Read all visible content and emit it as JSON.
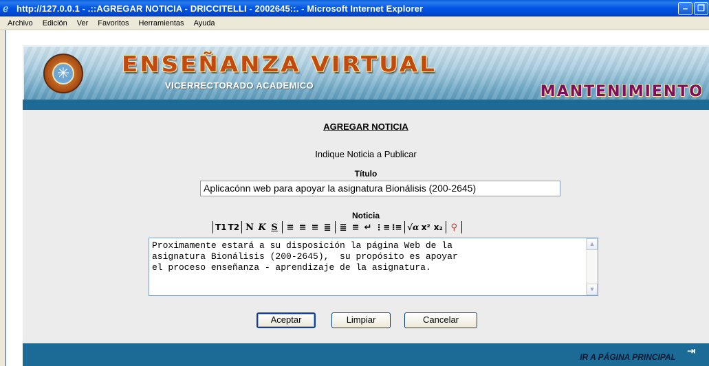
{
  "window": {
    "title": "http://127.0.0.1 - .::AGREGAR NOTICIA - DRICCITELLI - 2002645::. - Microsoft Internet Explorer",
    "minimize": "‒",
    "restore": "❐"
  },
  "menubar": {
    "items": [
      "Archivo",
      "Edición",
      "Ver",
      "Favoritos",
      "Herramientas",
      "Ayuda"
    ]
  },
  "banner": {
    "title": "ENSEÑANZA VIRTUAL",
    "subtitle": "VICERRECTORADO ACADEMICO",
    "section": "MANTENIMIENTO"
  },
  "form": {
    "page_title": "AGREGAR NOTICIA",
    "instruction": "Indique Noticia a Publicar",
    "titulo_label": "Título",
    "titulo_value": "Aplicacónn web para apoyar la asignatura Bionálisis (200-2645)",
    "noticia_label": "Noticia",
    "noticia_text": "Proximamente estará a su disposición la página Web de la\nasignatura Bionálisis (200-2645),  su propósito es apoyar\nel proceso enseñanza - aprendizaje de la asignatura."
  },
  "toolbar": {
    "t1": "T1",
    "t2": "T2",
    "n": "N",
    "k": "K",
    "s": "S",
    "sup": "x²",
    "sub": "x₂"
  },
  "buttons": {
    "accept": "Aceptar",
    "clear": "Limpiar",
    "cancel": "Cancelar"
  },
  "footer": {
    "link": "IR A PÁGINA PRINCIPAL"
  }
}
